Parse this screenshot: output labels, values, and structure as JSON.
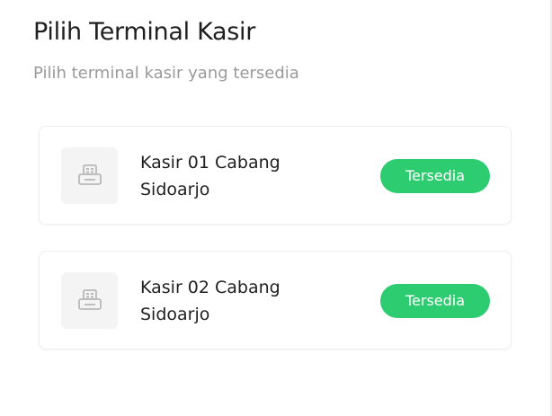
{
  "header": {
    "title": "Pilih Terminal Kasir",
    "subtitle": "Pilih terminal kasir yang tersedia"
  },
  "terminals": [
    {
      "name": "Kasir 01 Cabang Sidoarjo",
      "status": "Tersedia",
      "icon": "cash-register-icon"
    },
    {
      "name": "Kasir 02 Cabang Sidoarjo",
      "status": "Tersedia",
      "icon": "cash-register-icon"
    }
  ],
  "colors": {
    "status_available": "#2ecc71",
    "title_text": "#1f1f1f",
    "subtitle_text": "#9a9a9a",
    "icon_bg": "#f4f4f4"
  }
}
